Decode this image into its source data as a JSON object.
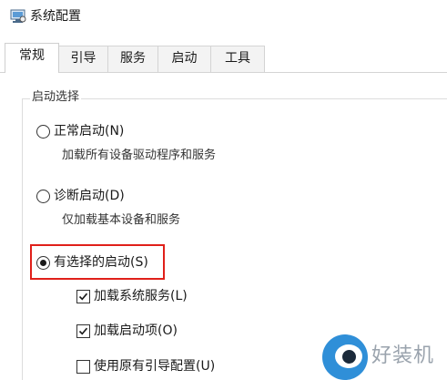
{
  "window": {
    "title": "系统配置",
    "icon": "system-config-icon"
  },
  "tabs": [
    {
      "label": "常规",
      "active": true
    },
    {
      "label": "引导",
      "active": false
    },
    {
      "label": "服务",
      "active": false
    },
    {
      "label": "启动",
      "active": false
    },
    {
      "label": "工具",
      "active": false
    }
  ],
  "startup_selection": {
    "legend": "启动选择",
    "options": [
      {
        "label": "正常启动(N)",
        "description": "加载所有设备驱动程序和服务",
        "checked": false
      },
      {
        "label": "诊断启动(D)",
        "description": "仅加载基本设备和服务",
        "checked": false
      },
      {
        "label": "有选择的启动(S)",
        "checked": true
      }
    ],
    "selective_items": [
      {
        "label": "加载系统服务(L)",
        "checked": true
      },
      {
        "label": "加载启动项(O)",
        "checked": true
      },
      {
        "label": "使用原有引导配置(U)",
        "checked": false
      }
    ]
  },
  "watermark": {
    "text": "好装机",
    "color": "#2f8fd8"
  },
  "colors": {
    "highlight": "#e0201a"
  }
}
